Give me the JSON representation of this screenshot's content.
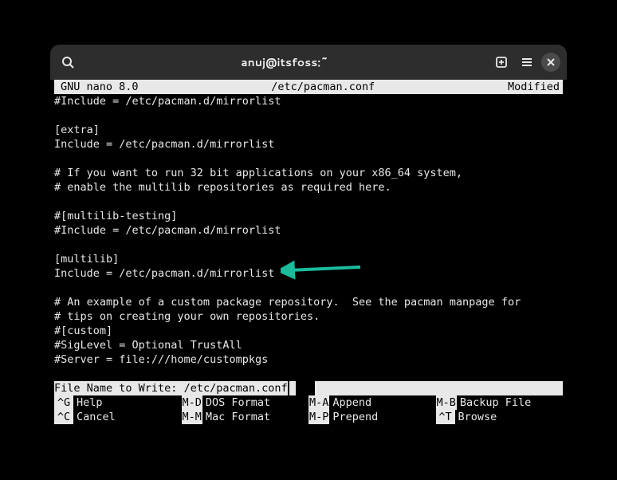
{
  "window": {
    "title": "anuj@itsfoss:~"
  },
  "editor": {
    "app_name": "GNU nano 8.0",
    "file_path": "/etc/pacman.conf",
    "status": "Modified",
    "lines": [
      "#Include = /etc/pacman.d/mirrorlist",
      "",
      "[extra]",
      "Include = /etc/pacman.d/mirrorlist",
      "",
      "# If you want to run 32 bit applications on your x86_64 system,",
      "# enable the multilib repositories as required here.",
      "",
      "#[multilib-testing]",
      "#Include = /etc/pacman.d/mirrorlist",
      "",
      "[multilib]",
      "Include = /etc/pacman.d/mirrorlist",
      "",
      "# An example of a custom package repository.  See the pacman manpage for",
      "# tips on creating your own repositories.",
      "#[custom]",
      "#SigLevel = Optional TrustAll",
      "#Server = file:///home/custompkgs",
      ""
    ],
    "prompt_label": "File Name to Write:",
    "prompt_value": "/etc/pacman.conf"
  },
  "shortcuts": {
    "row1": [
      {
        "key": "^G",
        "label": "Help"
      },
      {
        "key": "M-D",
        "label": "DOS Format"
      },
      {
        "key": "M-A",
        "label": "Append"
      },
      {
        "key": "M-B",
        "label": "Backup File"
      }
    ],
    "row2": [
      {
        "key": "^C",
        "label": "Cancel"
      },
      {
        "key": "M-M",
        "label": "Mac Format"
      },
      {
        "key": "M-P",
        "label": "Prepend"
      },
      {
        "key": "^T",
        "label": "Browse"
      }
    ]
  },
  "annotation": {
    "arrow_color": "#1abc9c"
  }
}
